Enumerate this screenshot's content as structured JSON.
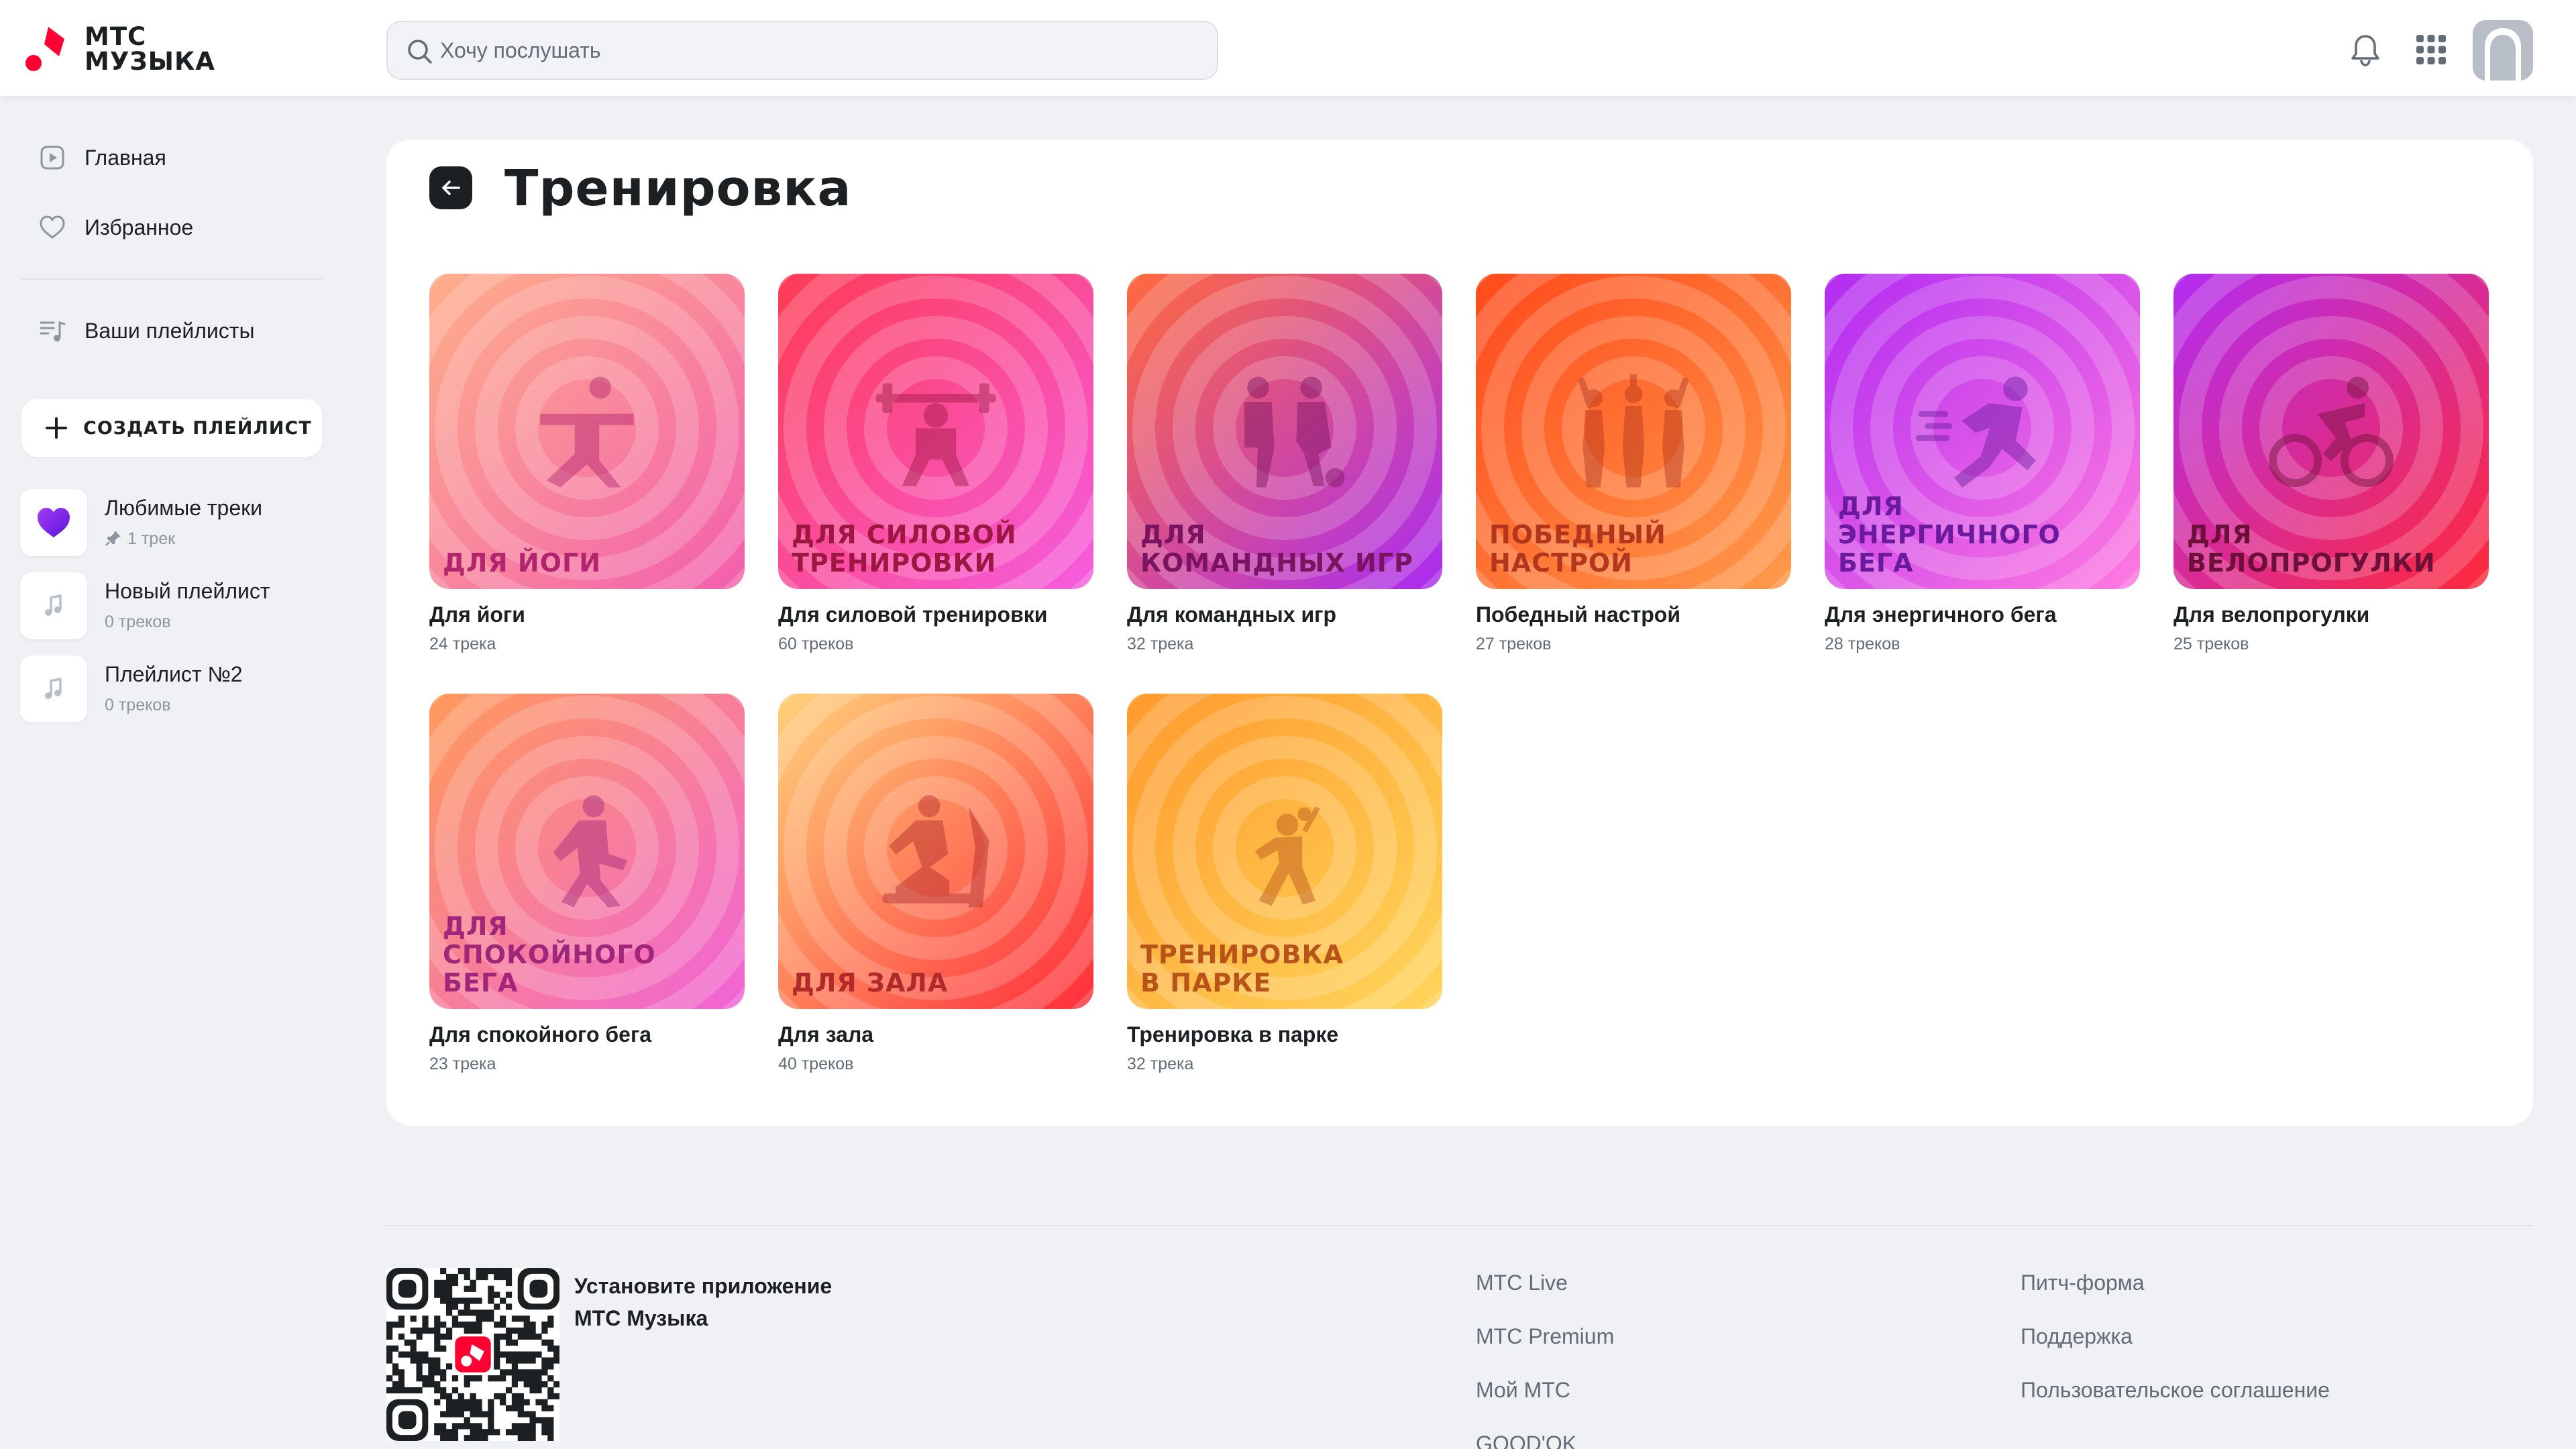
{
  "header": {
    "logo_line1": "МТС",
    "logo_line2": "МУЗЫКА",
    "search_placeholder": "Хочу послушать",
    "icons": [
      "search-icon",
      "bell-icon",
      "apps-grid-icon",
      "avatar"
    ]
  },
  "sidebar": {
    "nav": [
      {
        "label": "Главная",
        "icon": "home-play-icon"
      },
      {
        "label": "Избранное",
        "icon": "heart-icon"
      },
      {
        "label": "Ваши плейлисты",
        "icon": "playlist-icon"
      }
    ],
    "create_label": "+ СОЗДАТЬ ПЛЕЙЛИСТ",
    "create_text": "СОЗДАТЬ ПЛЕЙЛИСТ",
    "playlists": [
      {
        "title": "Любимые треки",
        "sub": "1 трек",
        "pinned": true
      },
      {
        "title": "Новый плейлист",
        "sub": "0 треков"
      },
      {
        "title": "Плейлист №2",
        "sub": "0 треков"
      }
    ]
  },
  "main": {
    "title": "Тренировка",
    "cards": [
      {
        "cover": "ДЛЯ ЙОГИ",
        "title": "Для йоги",
        "sub": "24 трека",
        "bg1": "#ffae8a",
        "bg2": "#f25fae",
        "text_color": "#b3246e"
      },
      {
        "cover": "ДЛЯ СИЛОВОЙ\nТРЕНИРОВКИ",
        "title": "Для силовой тренировки",
        "sub": "60 треков",
        "bg1": "#ff3b53",
        "bg2": "#f55de0",
        "text_color": "#9e1743"
      },
      {
        "cover": "ДЛЯ\nКОМАНДНЫХ ИГР",
        "title": "Для командных игр",
        "sub": "32 трека",
        "bg1": "#ff6a3d",
        "bg2": "#a92cf2",
        "text_color": "#7a1460"
      },
      {
        "cover": "ПОБЕДНЫЙ\nНАСТРОЙ",
        "title": "Победный настрой",
        "sub": "27 треков",
        "bg1": "#ff4a1c",
        "bg2": "#ff9a4a",
        "text_color": "#b3361c"
      },
      {
        "cover": "ДЛЯ ЭНЕРГИЧНОГО\nБЕГА",
        "title": "Для энергичного бега",
        "sub": "28 треков",
        "bg1": "#b22cf2",
        "bg2": "#ff7ae0",
        "text_color": "#6b1a9e"
      },
      {
        "cover": "ДЛЯ\nВЕЛОПРОГУЛКИ",
        "title": "Для велопрогулки",
        "sub": "25 треков",
        "bg1": "#b22cf2",
        "bg2": "#ff2a3a",
        "text_color": "#6e0f3a"
      },
      {
        "cover": "ДЛЯ\nСПОКОЙНОГО БЕГА",
        "title": "Для спокойного бега",
        "sub": "23 трека",
        "bg1": "#ff9a5a",
        "bg2": "#f063d6",
        "text_color": "#a0267a"
      },
      {
        "cover": "ДЛЯ ЗАЛА",
        "title": "Для зала",
        "sub": "40 треков",
        "bg1": "#ffd27a",
        "bg2": "#ff2d3a",
        "text_color": "#b02a2a"
      },
      {
        "cover": "ТРЕНИРОВКА\nВ ПАРКЕ",
        "title": "Тренировка в парке",
        "sub": "32 трека",
        "bg1": "#ff9a2e",
        "bg2": "#ffd65a",
        "text_color": "#b8541a"
      }
    ]
  },
  "footer": {
    "install_line1": "Установите приложение",
    "install_line2": "МТС Музыка",
    "col1": [
      "МТС Live",
      "МТС Premium",
      "Мой МТС",
      "GOOD'OK"
    ],
    "col2": [
      "Питч-форма",
      "Поддержка",
      "Пользовательское соглашение"
    ]
  },
  "colors": {
    "accent_red": "#ff0032",
    "heart_purple": "#7a1df2",
    "text_primary": "#1d2023",
    "text_secondary": "#626c77"
  }
}
